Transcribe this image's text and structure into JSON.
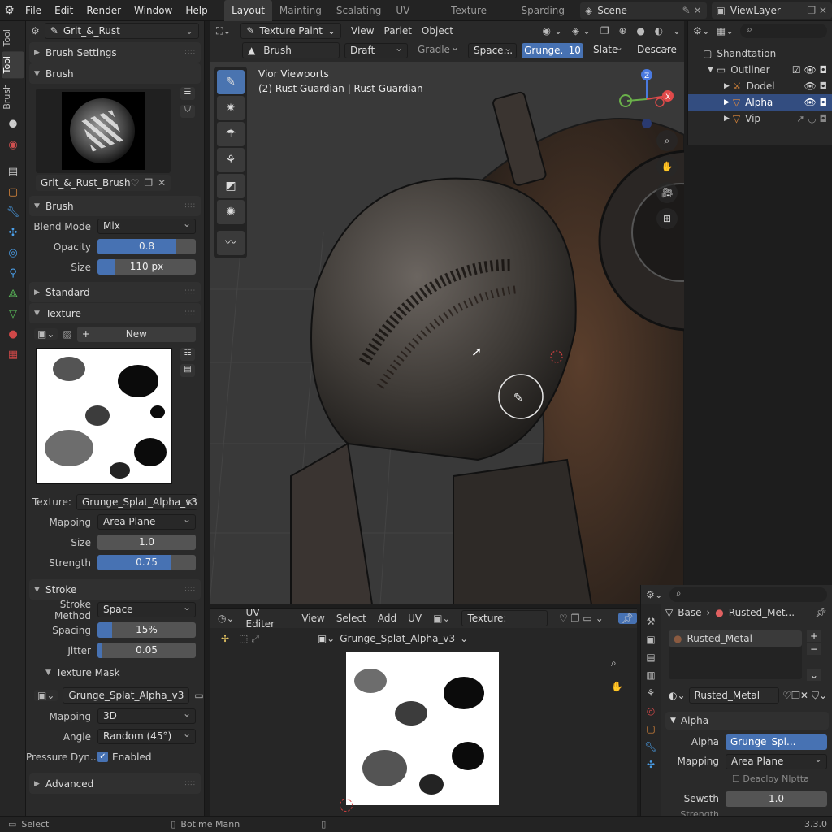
{
  "menu": {
    "file": "File",
    "edit": "Edit",
    "render": "Render",
    "window": "Window",
    "help": "Help"
  },
  "workspaces": [
    "Layout",
    "Mainting",
    "Scalating",
    "UV Editor",
    "Texture Paint",
    "Sparding"
  ],
  "scene": "Scene",
  "view_layer": "ViewLayer",
  "left_tabs": {
    "tool": "Tool",
    "tool2": "Tool",
    "brush": "Brush"
  },
  "props": {
    "brush_name": "Grit_&_Rust",
    "brush_settings": "Brush Settings",
    "brush_section": "Brush",
    "brush_preview_name": "Grit_&_Rust_Brush",
    "brush_sub": "Brush",
    "blend_mode_label": "Blend Mode",
    "blend_mode": "Mix",
    "opacity_label": "Opacity",
    "opacity": "0.8",
    "size_label": "Size",
    "size": "110 px",
    "standard": "Standard",
    "texture_section": "Texture",
    "new_label": "New",
    "texture_label": "Texture:",
    "texture_name": "Grunge_Splat_Alpha_v3",
    "mapping_label": "Mapping",
    "mapping": "Area Plane",
    "tsize_label": "Size",
    "tsize": "1.0",
    "strength_label": "Strength",
    "strength": "0.75",
    "stroke_section": "Stroke",
    "stroke_method_label": "Stroke Method",
    "stroke_method": "Space",
    "spacing_label": "Spacing",
    "spacing": "15%",
    "jitter_label": "Jitter",
    "jitter": "0.05",
    "texture_mask": "Texture Mask",
    "mask_name": "Grunge_Splat_Alpha_v3",
    "mask_mapping_label": "Mapping",
    "mask_mapping": "3D",
    "angle_label": "Angle",
    "angle": "Random (45°)",
    "pressure_label": "Pressure Dyn...",
    "pressure": "Enabled",
    "advanced": "Advanced"
  },
  "progress": {
    "opacity": 0.8,
    "strength": 0.75,
    "spacing": 0.15,
    "jitter": 0.05
  },
  "viewport": {
    "mode": "Texture Paint",
    "view": "View",
    "paint": "Pariet",
    "object": "Object",
    "brush_field": "Brush",
    "draft": "Draft",
    "gradle": "Gradle",
    "space": "Space...",
    "grunge": "Grunge.",
    "grunge_val": "10",
    "slate": "Slate",
    "descare": "Descare",
    "overlay_title": "Vior Viewports",
    "overlay_obj": "(2) Rust Guardian | Rust Guardian",
    "gizmo_x": "X",
    "gizmo_y": "Y",
    "gizmo_z": "Z"
  },
  "outliner": {
    "header": "Shandtation",
    "root": "Outliner",
    "items": [
      "Dodel",
      "Alpha",
      "Vip"
    ]
  },
  "uv": {
    "editor": "UV Editer",
    "view": "View",
    "select": "Select",
    "add": "Add",
    "uv": "UV",
    "texture_label": "Texture:",
    "image_name": "Grunge_Splat_Alpha_v3"
  },
  "material": {
    "base": "Base",
    "mat_short": "Rusted_Met...",
    "slot": "Rusted_Metal",
    "mat_name": "Rusted_Metal",
    "alpha_section": "Alpha",
    "alpha_label": "Alpha",
    "alpha_val": "Grunge_Spl...",
    "mapping_label": "Mapping",
    "mapping": "Area Plane",
    "deacloy": "Deacloy Nlptta",
    "sewsth_label": "Sewsth",
    "sewsth": "1.0",
    "strength_label": "Strength"
  },
  "status": {
    "select": "Select",
    "middle": "Botime Mann",
    "version": "3.3.0"
  },
  "colors": {
    "accent": "#4772b3",
    "selection": "#334d80",
    "panel": "#2a2a2a"
  }
}
